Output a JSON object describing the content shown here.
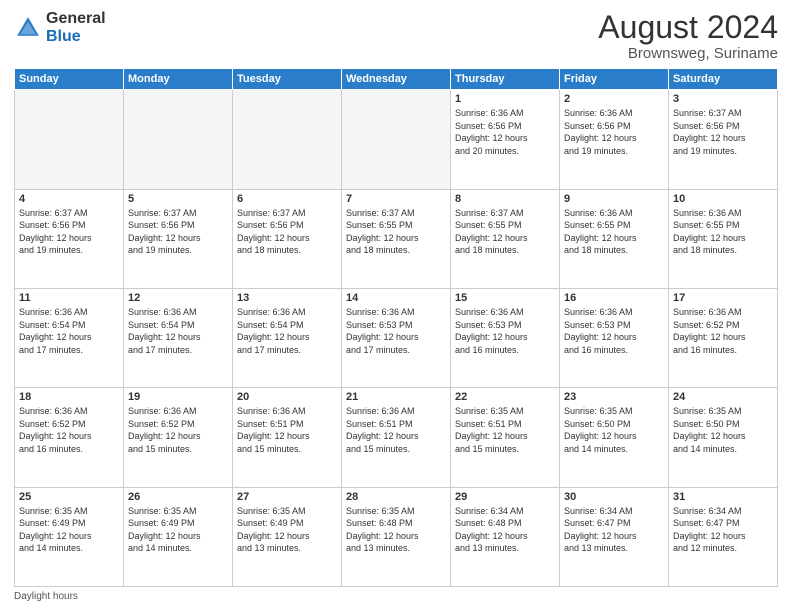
{
  "logo": {
    "general": "General",
    "blue": "Blue"
  },
  "header": {
    "month_year": "August 2024",
    "location": "Brownsweg, Suriname"
  },
  "days_of_week": [
    "Sunday",
    "Monday",
    "Tuesday",
    "Wednesday",
    "Thursday",
    "Friday",
    "Saturday"
  ],
  "weeks": [
    [
      {
        "day": "",
        "info": ""
      },
      {
        "day": "",
        "info": ""
      },
      {
        "day": "",
        "info": ""
      },
      {
        "day": "",
        "info": ""
      },
      {
        "day": "1",
        "info": "Sunrise: 6:36 AM\nSunset: 6:56 PM\nDaylight: 12 hours\nand 20 minutes."
      },
      {
        "day": "2",
        "info": "Sunrise: 6:36 AM\nSunset: 6:56 PM\nDaylight: 12 hours\nand 19 minutes."
      },
      {
        "day": "3",
        "info": "Sunrise: 6:37 AM\nSunset: 6:56 PM\nDaylight: 12 hours\nand 19 minutes."
      }
    ],
    [
      {
        "day": "4",
        "info": "Sunrise: 6:37 AM\nSunset: 6:56 PM\nDaylight: 12 hours\nand 19 minutes."
      },
      {
        "day": "5",
        "info": "Sunrise: 6:37 AM\nSunset: 6:56 PM\nDaylight: 12 hours\nand 19 minutes."
      },
      {
        "day": "6",
        "info": "Sunrise: 6:37 AM\nSunset: 6:56 PM\nDaylight: 12 hours\nand 18 minutes."
      },
      {
        "day": "7",
        "info": "Sunrise: 6:37 AM\nSunset: 6:55 PM\nDaylight: 12 hours\nand 18 minutes."
      },
      {
        "day": "8",
        "info": "Sunrise: 6:37 AM\nSunset: 6:55 PM\nDaylight: 12 hours\nand 18 minutes."
      },
      {
        "day": "9",
        "info": "Sunrise: 6:36 AM\nSunset: 6:55 PM\nDaylight: 12 hours\nand 18 minutes."
      },
      {
        "day": "10",
        "info": "Sunrise: 6:36 AM\nSunset: 6:55 PM\nDaylight: 12 hours\nand 18 minutes."
      }
    ],
    [
      {
        "day": "11",
        "info": "Sunrise: 6:36 AM\nSunset: 6:54 PM\nDaylight: 12 hours\nand 17 minutes."
      },
      {
        "day": "12",
        "info": "Sunrise: 6:36 AM\nSunset: 6:54 PM\nDaylight: 12 hours\nand 17 minutes."
      },
      {
        "day": "13",
        "info": "Sunrise: 6:36 AM\nSunset: 6:54 PM\nDaylight: 12 hours\nand 17 minutes."
      },
      {
        "day": "14",
        "info": "Sunrise: 6:36 AM\nSunset: 6:53 PM\nDaylight: 12 hours\nand 17 minutes."
      },
      {
        "day": "15",
        "info": "Sunrise: 6:36 AM\nSunset: 6:53 PM\nDaylight: 12 hours\nand 16 minutes."
      },
      {
        "day": "16",
        "info": "Sunrise: 6:36 AM\nSunset: 6:53 PM\nDaylight: 12 hours\nand 16 minutes."
      },
      {
        "day": "17",
        "info": "Sunrise: 6:36 AM\nSunset: 6:52 PM\nDaylight: 12 hours\nand 16 minutes."
      }
    ],
    [
      {
        "day": "18",
        "info": "Sunrise: 6:36 AM\nSunset: 6:52 PM\nDaylight: 12 hours\nand 16 minutes."
      },
      {
        "day": "19",
        "info": "Sunrise: 6:36 AM\nSunset: 6:52 PM\nDaylight: 12 hours\nand 15 minutes."
      },
      {
        "day": "20",
        "info": "Sunrise: 6:36 AM\nSunset: 6:51 PM\nDaylight: 12 hours\nand 15 minutes."
      },
      {
        "day": "21",
        "info": "Sunrise: 6:36 AM\nSunset: 6:51 PM\nDaylight: 12 hours\nand 15 minutes."
      },
      {
        "day": "22",
        "info": "Sunrise: 6:35 AM\nSunset: 6:51 PM\nDaylight: 12 hours\nand 15 minutes."
      },
      {
        "day": "23",
        "info": "Sunrise: 6:35 AM\nSunset: 6:50 PM\nDaylight: 12 hours\nand 14 minutes."
      },
      {
        "day": "24",
        "info": "Sunrise: 6:35 AM\nSunset: 6:50 PM\nDaylight: 12 hours\nand 14 minutes."
      }
    ],
    [
      {
        "day": "25",
        "info": "Sunrise: 6:35 AM\nSunset: 6:49 PM\nDaylight: 12 hours\nand 14 minutes."
      },
      {
        "day": "26",
        "info": "Sunrise: 6:35 AM\nSunset: 6:49 PM\nDaylight: 12 hours\nand 14 minutes."
      },
      {
        "day": "27",
        "info": "Sunrise: 6:35 AM\nSunset: 6:49 PM\nDaylight: 12 hours\nand 13 minutes."
      },
      {
        "day": "28",
        "info": "Sunrise: 6:35 AM\nSunset: 6:48 PM\nDaylight: 12 hours\nand 13 minutes."
      },
      {
        "day": "29",
        "info": "Sunrise: 6:34 AM\nSunset: 6:48 PM\nDaylight: 12 hours\nand 13 minutes."
      },
      {
        "day": "30",
        "info": "Sunrise: 6:34 AM\nSunset: 6:47 PM\nDaylight: 12 hours\nand 13 minutes."
      },
      {
        "day": "31",
        "info": "Sunrise: 6:34 AM\nSunset: 6:47 PM\nDaylight: 12 hours\nand 12 minutes."
      }
    ]
  ],
  "footer": {
    "daylight_label": "Daylight hours"
  }
}
